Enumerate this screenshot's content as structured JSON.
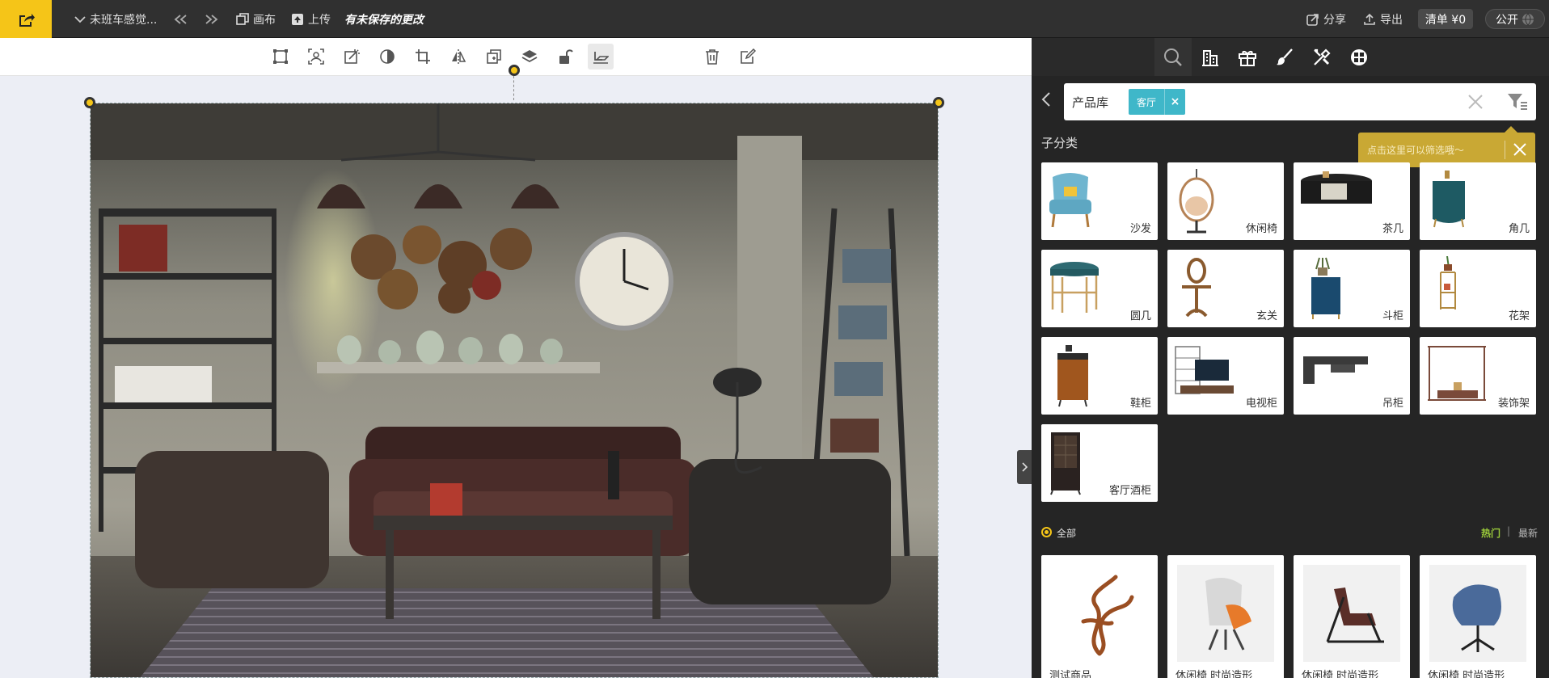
{
  "topbar": {
    "project_title": "未班车感觉...",
    "canvas_label": "画布",
    "upload_label": "上传",
    "unsaved_label": "有未保存的更改",
    "share_label": "分享",
    "export_label": "导出",
    "list_label": "清单 ¥0",
    "public_label": "公开"
  },
  "search": {
    "library_label": "产品库",
    "tag_label": "客厅",
    "tag_remove": "×"
  },
  "tooltip": {
    "text": "点击这里可以筛选哦～"
  },
  "subcategory": {
    "title": "子分类",
    "items": [
      {
        "label": "沙发",
        "icon": "armchair-icon"
      },
      {
        "label": "休闲椅",
        "icon": "hanging-chair-icon"
      },
      {
        "label": "茶几",
        "icon": "coffee-table-icon"
      },
      {
        "label": "角几",
        "icon": "side-table-icon"
      },
      {
        "label": "圆几",
        "icon": "round-table-icon"
      },
      {
        "label": "玄关",
        "icon": "entry-table-icon"
      },
      {
        "label": "斗柜",
        "icon": "chest-icon"
      },
      {
        "label": "花架",
        "icon": "flower-stand-icon"
      },
      {
        "label": "鞋柜",
        "icon": "shoe-cabinet-icon"
      },
      {
        "label": "电视柜",
        "icon": "tv-cabinet-icon"
      },
      {
        "label": "吊柜",
        "icon": "wall-cabinet-icon"
      },
      {
        "label": "装饰架",
        "icon": "decor-shelf-icon"
      },
      {
        "label": "客厅酒柜",
        "icon": "wine-cabinet-icon"
      }
    ]
  },
  "filter_bar": {
    "all_label": "全部",
    "hot_label": "热门",
    "separator": "|",
    "new_label": "最新"
  },
  "products": [
    {
      "name": "测试商品",
      "icon": "sculpture-icon"
    },
    {
      "name": "休闲椅 时尚造形",
      "icon": "orange-chair-icon"
    },
    {
      "name": "休闲椅 时尚造形",
      "icon": "leather-chair-icon"
    },
    {
      "name": "休闲椅 时尚造形",
      "icon": "blue-chair-icon"
    }
  ],
  "colors": {
    "accent": "#f5c518",
    "tag": "#3fb7c9",
    "hot": "#9ccc3a",
    "panel": "#252525"
  }
}
